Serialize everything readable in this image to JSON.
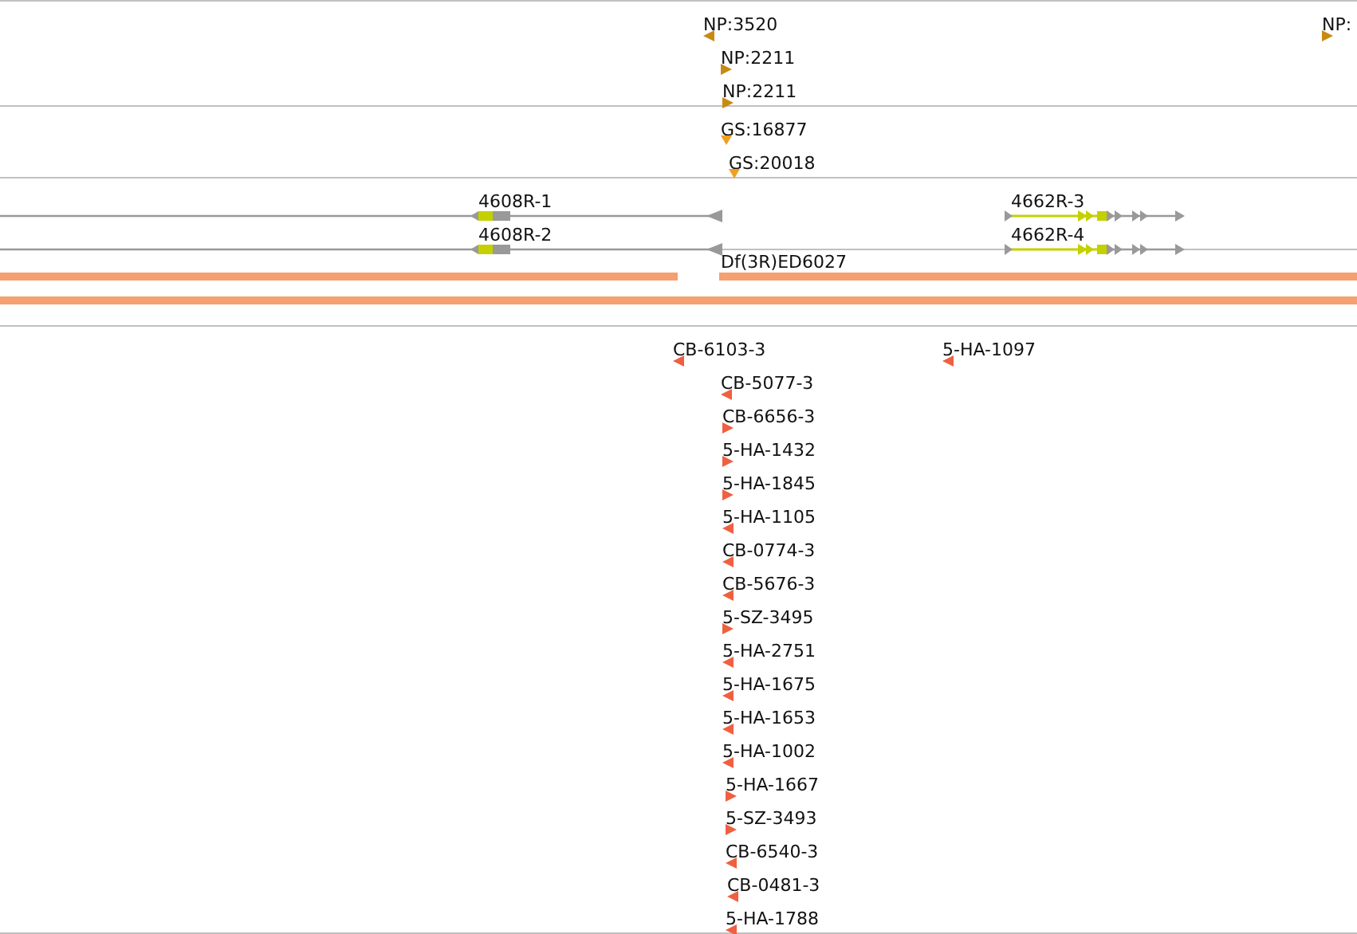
{
  "tracks": [
    {
      "kind": "features",
      "features": [
        {
          "label": "NP:3520",
          "reverse": true
        },
        {
          "label": "NP:2211",
          "reverse": false
        },
        {
          "label": "NP:2211",
          "reverse": false
        },
        {
          "label": "NP:",
          "reverse": false
        }
      ]
    },
    {
      "kind": "features",
      "features": [
        {
          "label": "GS:16877",
          "stranded": false
        },
        {
          "label": "GS:20018",
          "stranded": false
        }
      ]
    },
    {
      "kind": "transcripts",
      "features": [
        {
          "label": "4608R-1",
          "reverse": true
        },
        {
          "label": "4608R-2",
          "reverse": true
        },
        {
          "label": "4662R-3",
          "reverse": false
        },
        {
          "label": "4662R-4",
          "reverse": false
        }
      ]
    },
    {
      "kind": "deficiencies",
      "features": [
        {
          "kind": "split",
          "label": "Df(3R)ED6027"
        },
        {
          "kind": "full"
        }
      ]
    },
    {
      "kind": "insertions",
      "features": [
        {
          "label": "CB-6103-3",
          "reverse": true
        },
        {
          "label": "5-HA-1097",
          "reverse": true
        },
        {
          "label": "CB-5077-3",
          "reverse": true
        },
        {
          "label": "CB-6656-3",
          "reverse": false
        },
        {
          "label": "5-HA-1432",
          "reverse": false
        },
        {
          "label": "5-HA-1845",
          "reverse": false
        },
        {
          "label": "5-HA-1105",
          "reverse": true
        },
        {
          "label": "CB-0774-3",
          "reverse": true
        },
        {
          "label": "CB-5676-3",
          "reverse": true
        },
        {
          "label": "5-SZ-3495",
          "reverse": false
        },
        {
          "label": "5-HA-2751",
          "reverse": true
        },
        {
          "label": "5-HA-1675",
          "reverse": true
        },
        {
          "label": "5-HA-1653",
          "reverse": true
        },
        {
          "label": "5-HA-1002",
          "reverse": true
        },
        {
          "label": "5-HA-1667",
          "reverse": false
        },
        {
          "label": "5-SZ-3493",
          "reverse": false
        },
        {
          "label": "CB-6540-3",
          "reverse": true
        },
        {
          "label": "CB-0481-3",
          "reverse": true
        },
        {
          "label": "5-HA-1788",
          "reverse": true
        }
      ]
    }
  ]
}
